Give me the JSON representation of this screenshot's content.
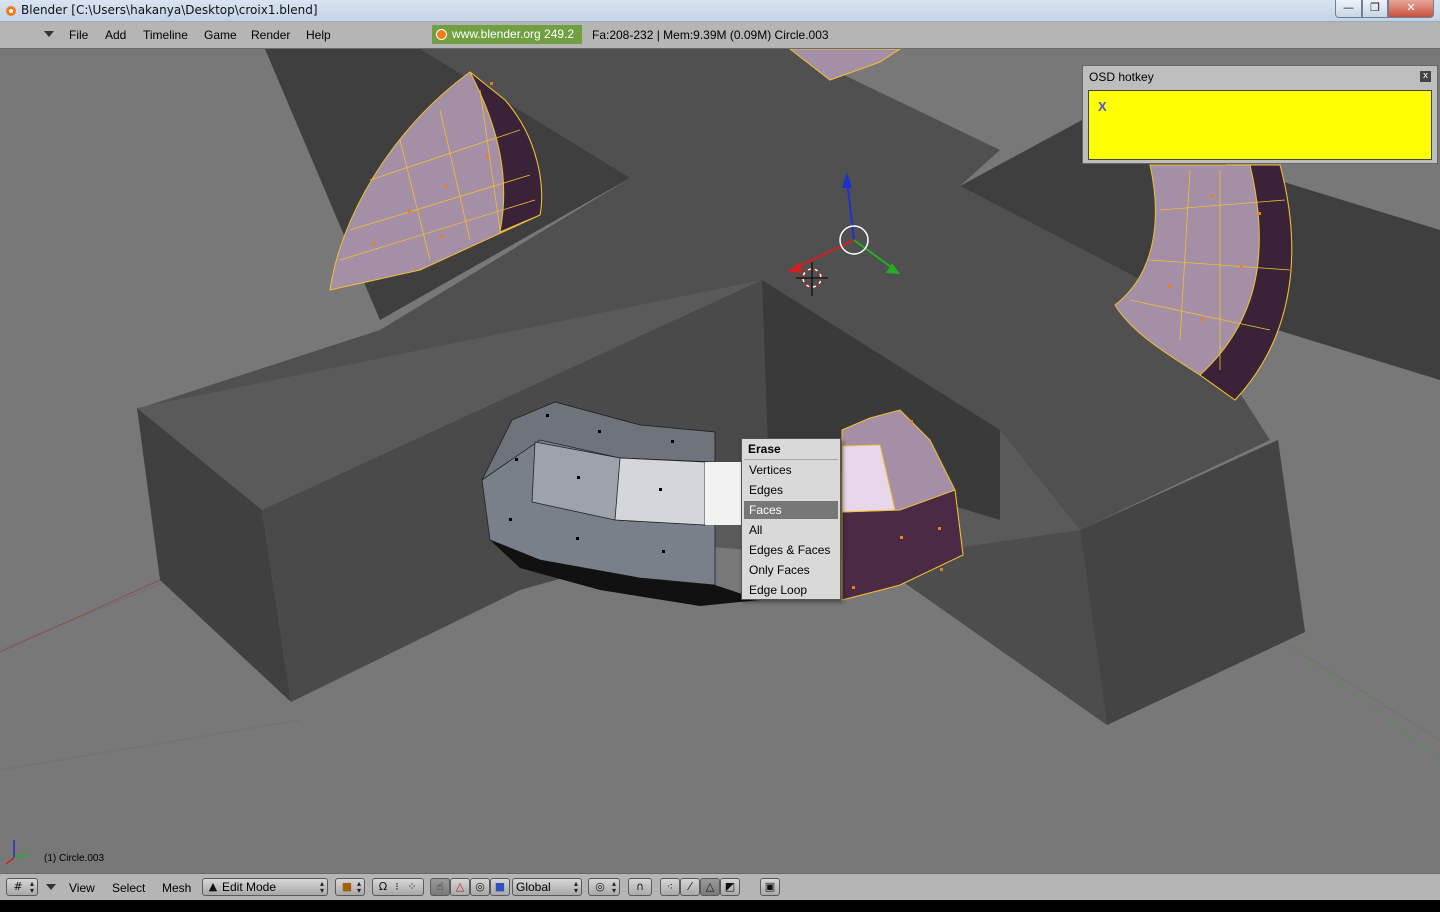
{
  "window": {
    "title": "Blender [C:\\Users\\hakanya\\Desktop\\croix1.blend]",
    "minimize_label": "—",
    "maximize_label": "❐",
    "close_label": "✕"
  },
  "top_header": {
    "menus": [
      "File",
      "Add",
      "Timeline",
      "Game",
      "Render",
      "Help"
    ],
    "url_badge": "www.blender.org 249.2",
    "stats": "Fa:208-232 | Mem:9.39M (0.09M) Circle.003"
  },
  "osd": {
    "title": "OSD hotkey",
    "close_label": "x",
    "key": "X"
  },
  "erase_menu": {
    "title": "Erase",
    "options": [
      "Vertices",
      "Edges",
      "Faces",
      "All",
      "Edges & Faces",
      "Only Faces",
      "Edge Loop"
    ],
    "highlighted": "Faces"
  },
  "viewport": {
    "object_name": "(1) Circle.003"
  },
  "bottom_header": {
    "menus": [
      "View",
      "Select",
      "Mesh"
    ],
    "mode": "Edit Mode",
    "orientation": "Global"
  },
  "colors": {
    "viewport_bg": "#787878",
    "selected_face": "#a48fa6",
    "selected_edge": "#f0c030",
    "vertex": "#f07d14",
    "osd_bg": "#ffff00",
    "url_badge": "#70a042"
  }
}
